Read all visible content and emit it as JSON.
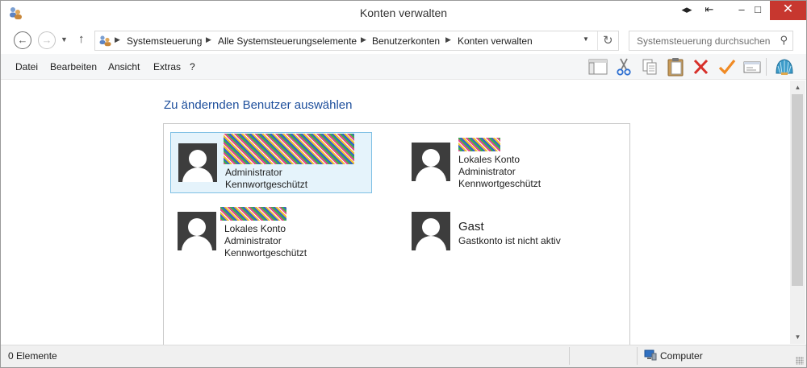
{
  "window": {
    "title": "Konten verwalten"
  },
  "breadcrumb": [
    "Systemsteuerung",
    "Alle Systemsteuerungselemente",
    "Benutzerkonten",
    "Konten verwalten"
  ],
  "search": {
    "placeholder": "Systemsteuerung durchsuchen"
  },
  "menu": [
    "Datei",
    "Bearbeiten",
    "Ansicht",
    "Extras",
    "?"
  ],
  "toolbar_icons": [
    "layout-icon",
    "cut-icon",
    "copy-icon",
    "paste-icon",
    "delete-icon",
    "check-icon",
    "properties-icon",
    "shell-icon"
  ],
  "main": {
    "heading": "Zu ändernden Benutzer auswählen",
    "accounts": [
      {
        "name": "",
        "name_redacted": true,
        "lines": [
          "Administrator",
          "Kennwortgeschützt"
        ],
        "selected": true
      },
      {
        "name": "",
        "name_redacted": true,
        "lines": [
          "Lokales Konto",
          "Administrator",
          "Kennwortgeschützt"
        ],
        "selected": false
      },
      {
        "name": "",
        "name_redacted": true,
        "lines": [
          "Lokales Konto",
          "Administrator",
          "Kennwortgeschützt"
        ],
        "selected": false
      },
      {
        "name": "Gast",
        "name_redacted": false,
        "lines": [
          "Gastkonto ist nicht aktiv"
        ],
        "selected": false
      }
    ]
  },
  "status": {
    "items_count": "0 Elemente",
    "location": "Computer"
  },
  "colors": {
    "heading": "#1e4f9c",
    "selection_bg": "#e5f3fb",
    "selection_border": "#7fc0e4",
    "close_button": "#c7372f"
  }
}
